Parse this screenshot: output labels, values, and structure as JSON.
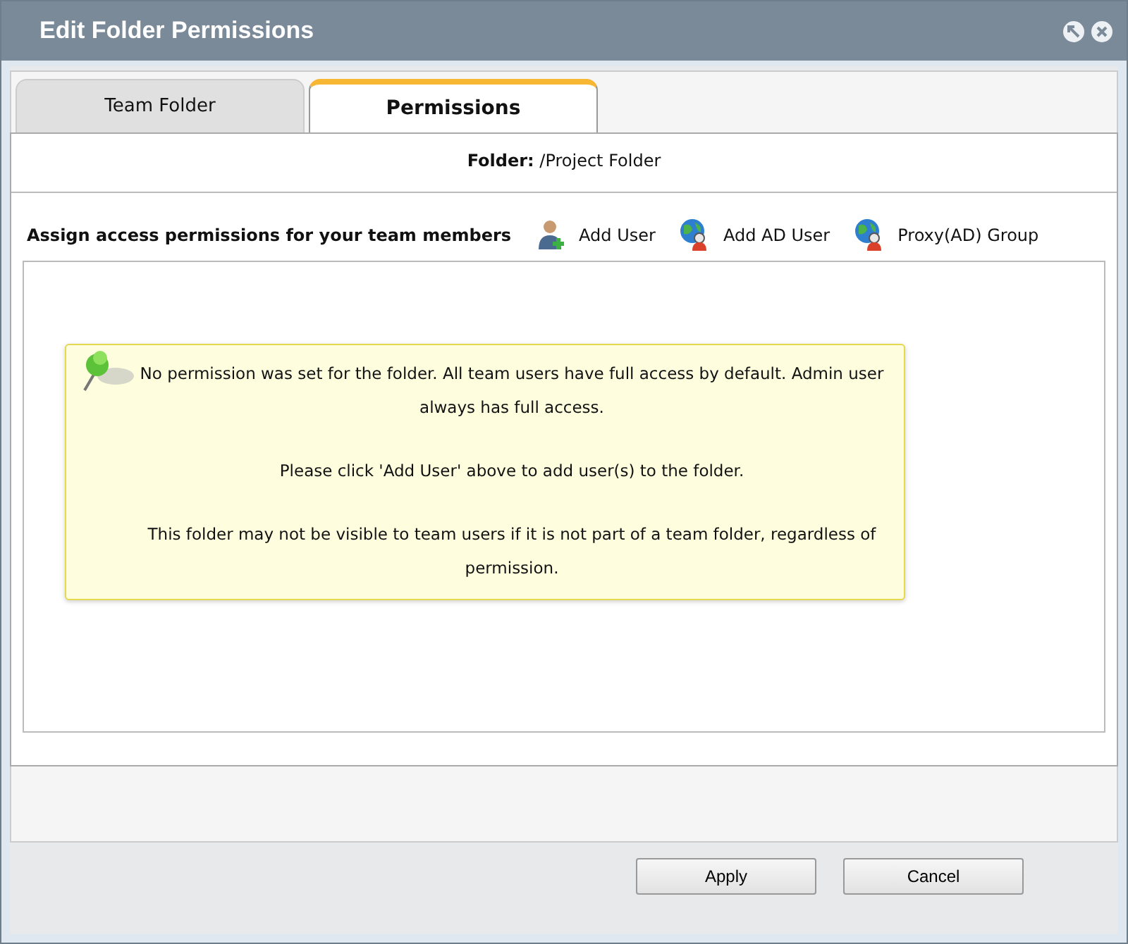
{
  "window": {
    "title": "Edit Folder Permissions"
  },
  "tabs": [
    {
      "label": "Team Folder",
      "selected": false
    },
    {
      "label": "Permissions",
      "selected": true
    }
  ],
  "folder_line": "**Folder:** /Project Folder",
  "toolbar": {
    "label": "Assign access permissions for your team members",
    "actions": [
      {
        "kind": "user",
        "label": "Add User"
      },
      {
        "kind": "ad-user",
        "label": "Add AD User"
      },
      {
        "kind": "ad-group",
        "label": "Proxy(AD) Group"
      }
    ]
  },
  "note": [
    "No permission was set for the folder. All team users have full access by default. Admin user always has full access.",
    "Please click 'Add User' above to add user(s) to the folder.",
    "This folder may not be visible to team users if it is not part of a team folder, regardless of permission."
  ],
  "buttons": [
    "Apply",
    "Cancel"
  ]
}
